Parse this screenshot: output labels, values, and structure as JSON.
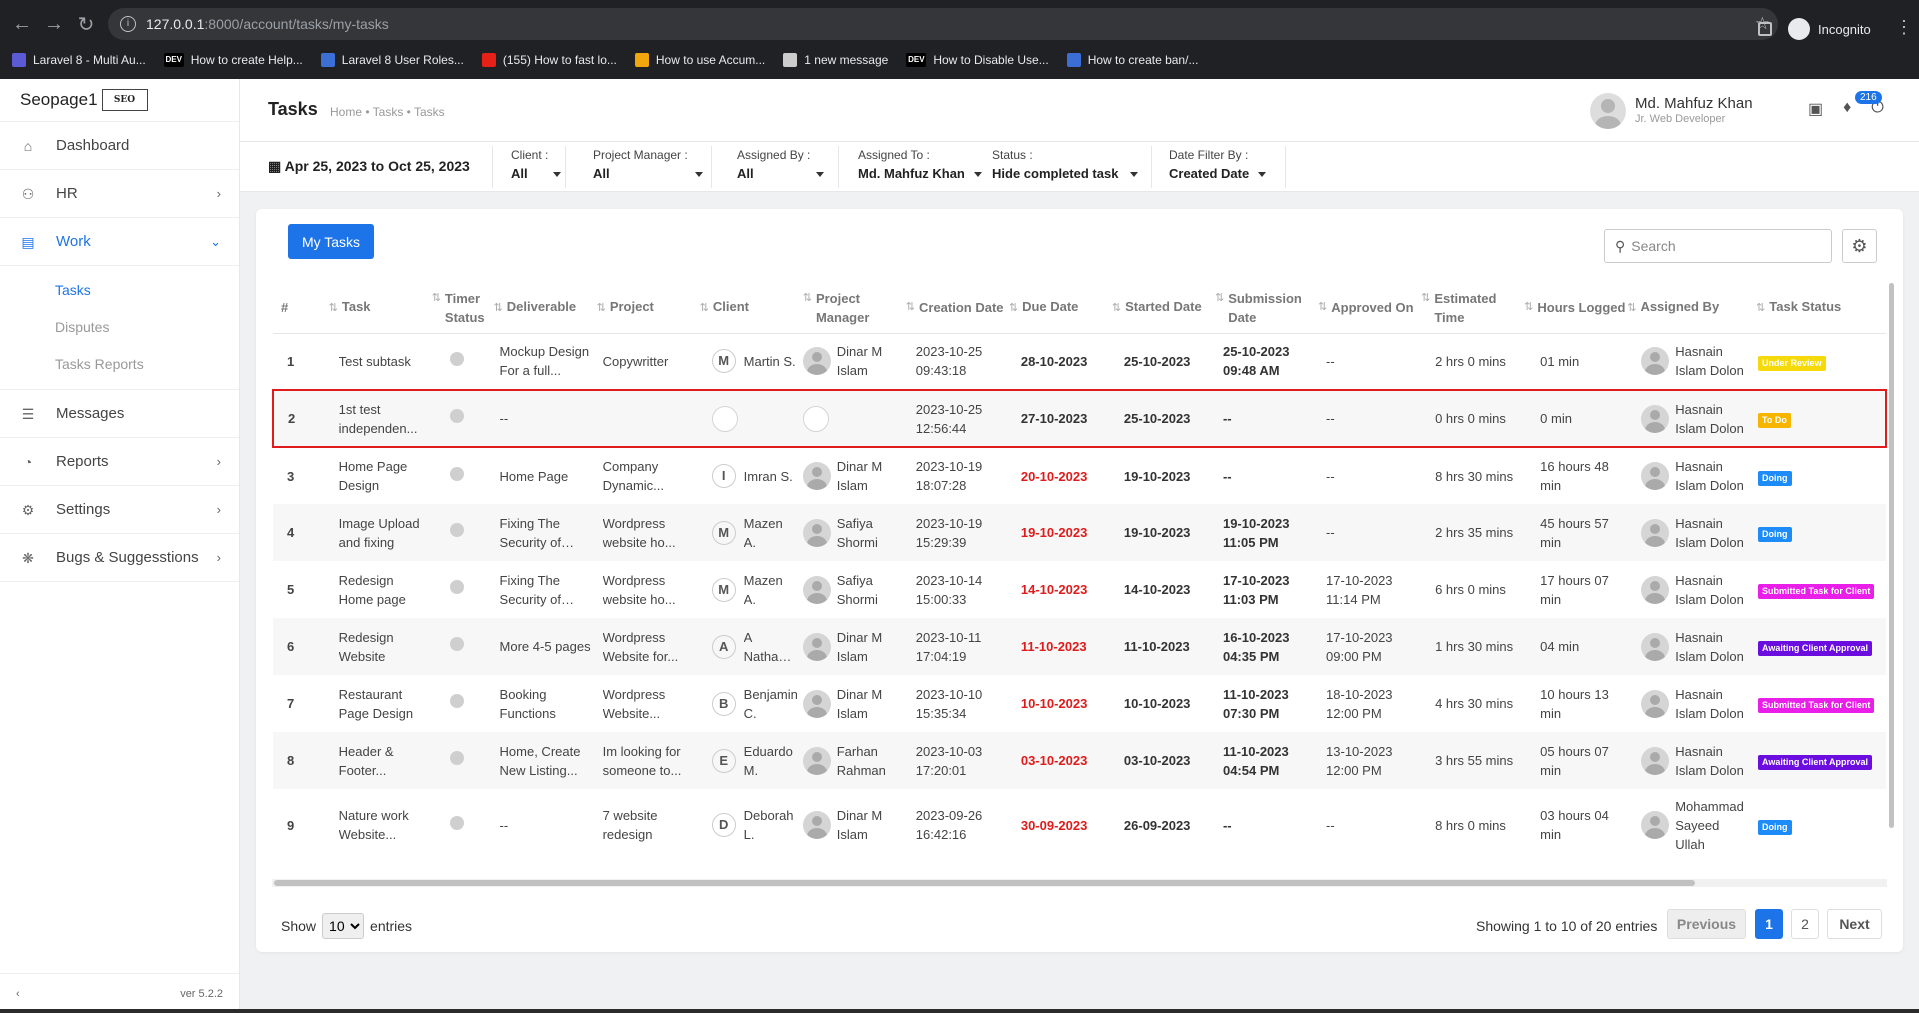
{
  "browser": {
    "url_host": "127.0.0.1",
    "url_path": ":8000/account/tasks/my-tasks",
    "profile_label": "Incognito",
    "bookmarks": [
      {
        "label": "Laravel 8 - Multi Au...",
        "color": "#5b5bd6"
      },
      {
        "label": "How to create Help...",
        "color": "#000000",
        "tag": "DEV"
      },
      {
        "label": "Laravel 8 User Roles...",
        "color": "#3b6fd6"
      },
      {
        "label": "(155) How to fast lo...",
        "color": "#e62117"
      },
      {
        "label": "How to use Accum...",
        "color": "#f2a60d"
      },
      {
        "label": "1 new message",
        "color": "#cccccc"
      },
      {
        "label": "How to Disable Use...",
        "color": "#000000",
        "tag": "DEV"
      },
      {
        "label": "How to create ban/...",
        "color": "#3b6fd6"
      }
    ]
  },
  "sidebar": {
    "brand": "Seopage1",
    "brand_logo": "SEO",
    "items": [
      {
        "label": "Dashboard",
        "icon": "home-icon"
      },
      {
        "label": "HR",
        "icon": "users-icon"
      },
      {
        "label": "Work",
        "icon": "briefcase-icon"
      },
      {
        "label": "Messages",
        "icon": "message-icon"
      },
      {
        "label": "Reports",
        "icon": "pie-chart-icon"
      },
      {
        "label": "Settings",
        "icon": "gear-icon"
      },
      {
        "label": "Bugs & Suggesstions",
        "icon": "bug-icon"
      }
    ],
    "work_sub": [
      "Tasks",
      "Disputes",
      "Tasks Reports"
    ],
    "version": "ver 5.2.2"
  },
  "header": {
    "title": "Tasks",
    "breadcrumb": "Home • Tasks • Tasks",
    "user_name": "Md. Mahfuz Khan",
    "user_role": "Jr. Web Developer",
    "notification_count": "216"
  },
  "filters": {
    "date_range": "Apr 25, 2023 to Oct 25, 2023",
    "client": {
      "label": "Client :",
      "value": "All"
    },
    "project_manager": {
      "label": "Project Manager :",
      "value": "All"
    },
    "assigned_by": {
      "label": "Assigned By :",
      "value": "All"
    },
    "assigned_to": {
      "label": "Assigned To :",
      "value": "Md. Mahfuz Khan"
    },
    "status": {
      "label": "Status :",
      "value": "Hide completed task"
    },
    "date_filter": {
      "label": "Date Filter By :",
      "value": "Created Date"
    }
  },
  "toolbar": {
    "my_tasks_label": "My Tasks",
    "search_placeholder": "Search"
  },
  "table": {
    "headers": {
      "num": "#",
      "task": "Task",
      "timer": "Timer Status",
      "deliverable": "Deliverable",
      "project": "Project",
      "client": "Client",
      "pm": "Project Manager",
      "created": "Creation Date",
      "due": "Due Date",
      "started": "Started Date",
      "submission": "Submission Date",
      "approved": "Approved On",
      "estimated": "Estimated Time",
      "logged": "Hours Logged",
      "assigned_by": "Assigned By",
      "status": "Task Status"
    },
    "rows": [
      {
        "num": "1",
        "task": "Test subtask",
        "deliverable": "Mockup Design For a full...",
        "project": "Copywritter",
        "client_initial": "M",
        "client": "Martin S.",
        "pm": "Dinar M Islam",
        "created": "2023-10-25 09:43:18",
        "due": "28-10-2023",
        "due_red": false,
        "started": "25-10-2023",
        "submission": "25-10-2023 09:48 AM",
        "approved": "--",
        "estimated": "2 hrs 0 mins",
        "logged": "01 min",
        "assigned_by": "Hasnain Islam Dolon",
        "status": "Under Review",
        "status_color": "#f5d90a",
        "status_text_color": "#ffffff"
      },
      {
        "num": "2",
        "task": "1st test independen...",
        "deliverable": "--",
        "project": "",
        "client_initial": "",
        "client": "",
        "pm": "",
        "created": "2023-10-25 12:56:44",
        "due": "27-10-2023",
        "due_red": false,
        "started": "25-10-2023",
        "submission": "--",
        "approved": "--",
        "estimated": "0 hrs 0 mins",
        "logged": "0 min",
        "assigned_by": "Hasnain Islam Dolon",
        "status": "To Do",
        "status_color": "#f7b500",
        "status_text_color": "#ffffff"
      },
      {
        "num": "3",
        "task": "Home Page Design",
        "deliverable": "Home Page",
        "project": "Company Dynamic...",
        "client_initial": "I",
        "client": "Imran S.",
        "pm": "Dinar M Islam",
        "created": "2023-10-19 18:07:28",
        "due": "20-10-2023",
        "due_red": true,
        "started": "19-10-2023",
        "submission": "--",
        "approved": "--",
        "estimated": "8 hrs 30 mins",
        "logged": "16 hours 48 min",
        "assigned_by": "Hasnain Islam Dolon",
        "status": "Doing",
        "status_color": "#1d8cf8",
        "status_text_color": "#ffffff"
      },
      {
        "num": "4",
        "task": "Image Upload and fixing",
        "deliverable": "Fixing The Security of the...",
        "project": "Wordpress website ho...",
        "client_initial": "M",
        "client": "Mazen A.",
        "pm": "Safiya Shormi",
        "created": "2023-10-19 15:29:39",
        "due": "19-10-2023",
        "due_red": true,
        "started": "19-10-2023",
        "submission": "19-10-2023 11:05 PM",
        "approved": "--",
        "estimated": "2 hrs 35 mins",
        "logged": "45 hours 57 min",
        "assigned_by": "Hasnain Islam Dolon",
        "status": "Doing",
        "status_color": "#1d8cf8",
        "status_text_color": "#ffffff"
      },
      {
        "num": "5",
        "task": "Redesign Home page",
        "deliverable": "Fixing The Security of the...",
        "project": "Wordpress website ho...",
        "client_initial": "M",
        "client": "Mazen A.",
        "pm": "Safiya Shormi",
        "created": "2023-10-14 15:00:33",
        "due": "14-10-2023",
        "due_red": true,
        "started": "14-10-2023",
        "submission": "17-10-2023 11:03 PM",
        "approved": "17-10-2023 11:14 PM",
        "estimated": "6 hrs 0 mins",
        "logged": "17 hours 07 min",
        "assigned_by": "Hasnain Islam Dolon",
        "status": "Submitted Task for Client",
        "status_color": "#e91ee9",
        "status_text_color": "#ffffff"
      },
      {
        "num": "6",
        "task": "Redesign Website",
        "deliverable": "More 4-5 pages",
        "project": "Wordpress Website for...",
        "client_initial": "A",
        "client": "A Nathan M.",
        "pm": "Dinar M Islam",
        "created": "2023-10-11 17:04:19",
        "due": "11-10-2023",
        "due_red": true,
        "started": "11-10-2023",
        "submission": "16-10-2023 04:35 PM",
        "approved": "17-10-2023 09:00 PM",
        "estimated": "1 hrs 30 mins",
        "logged": "04 min",
        "assigned_by": "Hasnain Islam Dolon",
        "status": "Awaiting Client Approval",
        "status_color": "#6a0dde",
        "status_text_color": "#ffffff"
      },
      {
        "num": "7",
        "task": "Restaurant Page Design",
        "deliverable": "Booking Functions",
        "project": "Wordpress Website...",
        "client_initial": "B",
        "client": "Benjamin C.",
        "pm": "Dinar M Islam",
        "created": "2023-10-10 15:35:34",
        "due": "10-10-2023",
        "due_red": true,
        "started": "10-10-2023",
        "submission": "11-10-2023 07:30 PM",
        "approved": "18-10-2023 12:00 PM",
        "estimated": "4 hrs 30 mins",
        "logged": "10 hours 13 min",
        "assigned_by": "Hasnain Islam Dolon",
        "status": "Submitted Task for Client",
        "status_color": "#e91ee9",
        "status_text_color": "#ffffff"
      },
      {
        "num": "8",
        "task": "Header & Footer...",
        "deliverable": "Home, Create New Listing...",
        "project": "Im looking for someone to...",
        "client_initial": "E",
        "client": "Eduardo M.",
        "pm": "Farhan Rahman",
        "created": "2023-10-03 17:20:01",
        "due": "03-10-2023",
        "due_red": true,
        "started": "03-10-2023",
        "submission": "11-10-2023 04:54 PM",
        "approved": "13-10-2023 12:00 PM",
        "estimated": "3 hrs 55 mins",
        "logged": "05 hours 07 min",
        "assigned_by": "Hasnain Islam Dolon",
        "status": "Awaiting Client Approval",
        "status_color": "#6a0dde",
        "status_text_color": "#ffffff"
      },
      {
        "num": "9",
        "task": "Nature work Website...",
        "deliverable": "--",
        "project": "7 website redesign",
        "client_initial": "D",
        "client": "Deborah L.",
        "pm": "Dinar M Islam",
        "created": "2023-09-26 16:42:16",
        "due": "30-09-2023",
        "due_red": true,
        "started": "26-09-2023",
        "submission": "--",
        "approved": "--",
        "estimated": "8 hrs 0 mins",
        "logged": "03 hours 04 min",
        "assigned_by": "Mohammad Sayeed Ullah",
        "status": "Doing",
        "status_color": "#1d8cf8",
        "status_text_color": "#ffffff"
      }
    ]
  },
  "footer": {
    "show_label": "Show",
    "entries_value": "10",
    "entries_label": "entries",
    "showing_info": "Showing 1 to 10 of 20 entries",
    "prev_label": "Previous",
    "page1": "1",
    "page2": "2",
    "next_label": "Next"
  }
}
